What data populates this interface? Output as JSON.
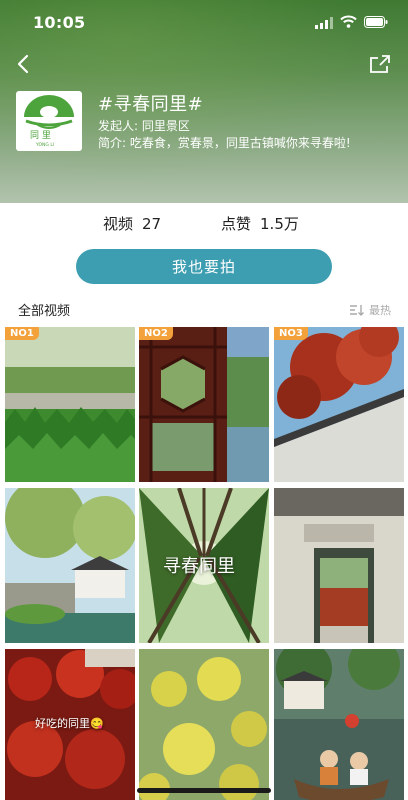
{
  "status_bar": {
    "time": "10:05"
  },
  "topic": {
    "title": "#寻春同里#",
    "initiator": "发起人: 同里景区",
    "description": "简介: 吃春食，赏春景，同里古镇喊你来寻春啦!",
    "logo_text": "YONG LI",
    "logo_glyphs": "同  里"
  },
  "stats": {
    "videos_label": "视频",
    "videos_value": "27",
    "likes_label": "点赞",
    "likes_value": "1.5万"
  },
  "shoot_button": "我也要拍",
  "section": {
    "title": "全部视频",
    "sort_label": "最热"
  },
  "tiles": [
    {
      "rank": "NO1"
    },
    {
      "rank": "NO2"
    },
    {
      "rank": "NO3"
    },
    {
      "caption": ""
    },
    {
      "caption": "寻春同里"
    },
    {
      "caption": ""
    },
    {
      "caption": "好吃的同里😋"
    },
    {
      "caption": ""
    },
    {
      "caption": ""
    }
  ],
  "colors": {
    "accent": "#3d9eb2",
    "rank_badge": "#f2a13b",
    "hero_green": "#4f8a3e"
  }
}
